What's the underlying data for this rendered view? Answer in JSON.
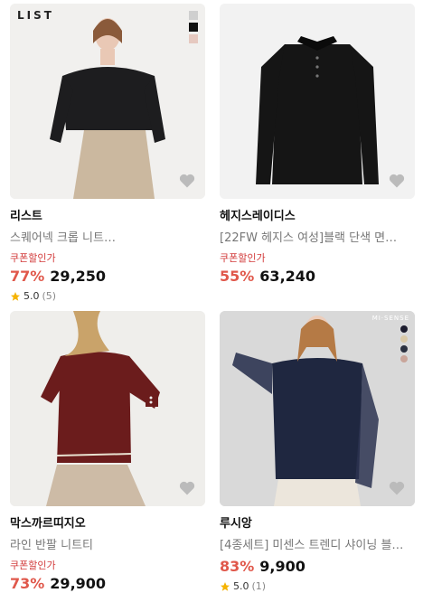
{
  "products": [
    {
      "brand": "리스트",
      "name": "스퀘어넥 크롭 니트…",
      "coupon_label": "쿠폰할인가",
      "discount": "77%",
      "price": "29,250",
      "rating": "5.0",
      "review_count": "(5)",
      "logo_text": "LIST",
      "swatches": [
        "#cfcfcf",
        "#111111",
        "#e6c9c0"
      ]
    },
    {
      "brand": "헤지스레이디스",
      "name": "[22FW 헤지스 여성]블랙 단색 면…",
      "coupon_label": "쿠폰할인가",
      "discount": "55%",
      "price": "63,240"
    },
    {
      "brand": "막스까르띠지오",
      "name": "라인 반팔 니트티",
      "coupon_label": "쿠폰할인가",
      "discount": "73%",
      "price": "29,900"
    },
    {
      "brand": "루시앙",
      "name": "[4종세트] 미센스 트렌디 샤이닝 블…",
      "discount": "83%",
      "price": "9,900",
      "rating": "5.0",
      "review_count": "(1)",
      "logo_text": "MI·SENSE",
      "swatches": [
        "#1c1c2e",
        "#d9c9a8",
        "#2a3040",
        "#c9a59a"
      ]
    }
  ],
  "colors": {
    "discount": "#e0584b",
    "coupon": "#d23b3b",
    "star": "#f5b301",
    "heart": "#bbbbbb"
  }
}
